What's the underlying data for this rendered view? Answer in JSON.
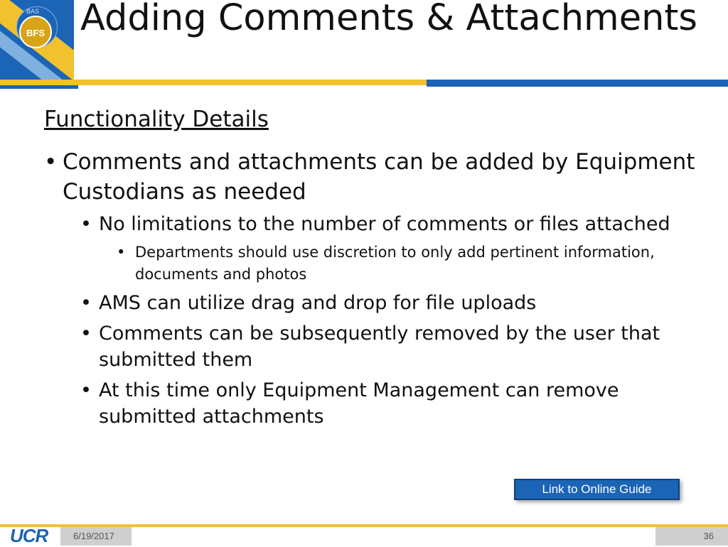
{
  "logo": {
    "top_text": "BAS",
    "seal_text": "BFS",
    "footer_brand": "UCR"
  },
  "title": "Adding Comments & Attachments",
  "section_heading": "Functionality Details",
  "bullets": [
    {
      "level": 1,
      "text": "Comments and attachments can be added by Equipment Custodians as needed"
    },
    {
      "level": 2,
      "text": "No limitations to the number of comments or files attached"
    },
    {
      "level": 3,
      "text": "Departments should use discretion to only add pertinent information, documents and photos"
    },
    {
      "level": 2,
      "text": "AMS can utilize drag and drop for file uploads"
    },
    {
      "level": 2,
      "text": "Comments can be subsequently removed by the user that submitted them"
    },
    {
      "level": 2,
      "text": "At this time only Equipment Management can remove submitted attachments"
    }
  ],
  "link_button": "Link to Online Guide",
  "footer": {
    "date": "6/19/2017",
    "page": "36"
  },
  "colors": {
    "brand_blue": "#1c64b6",
    "brand_gold": "#f2c12e"
  }
}
